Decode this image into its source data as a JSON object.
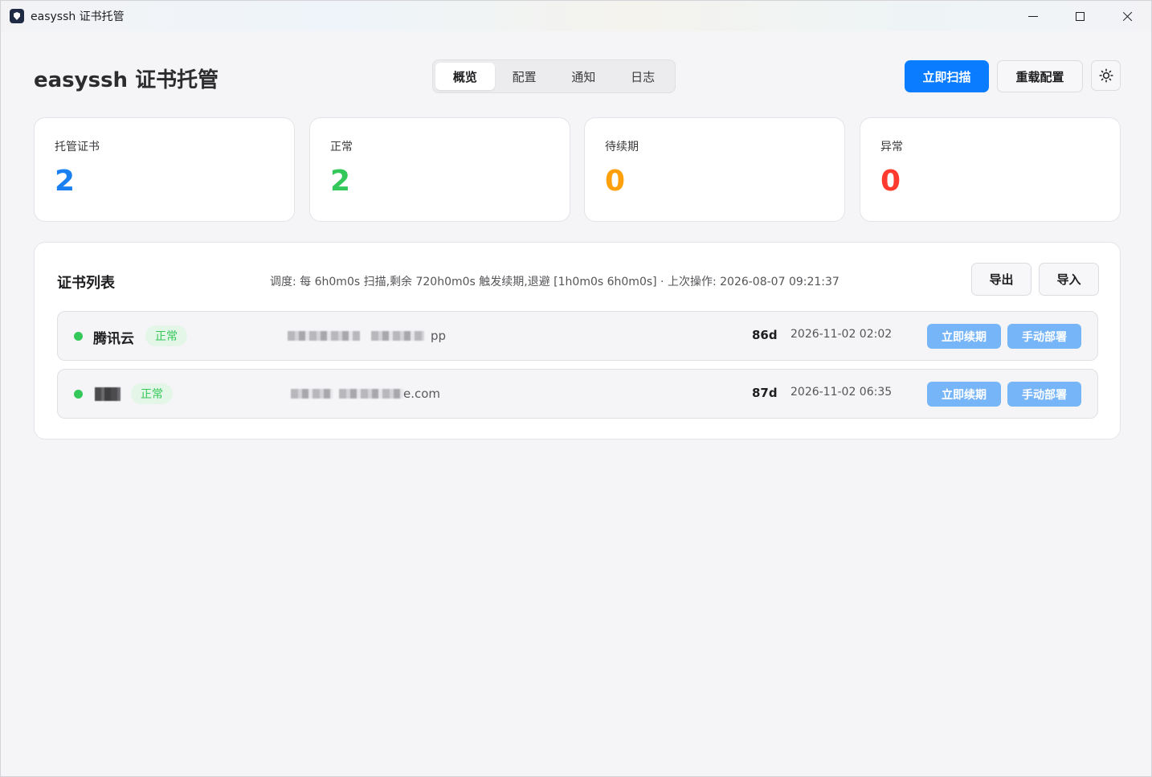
{
  "window": {
    "title": "easyssh 证书托管",
    "icon": "shield-icon"
  },
  "header": {
    "title": "easyssh 证书托管",
    "tabs": [
      {
        "label": "概览",
        "active": true
      },
      {
        "label": "配置",
        "active": false
      },
      {
        "label": "通知",
        "active": false
      },
      {
        "label": "日志",
        "active": false
      }
    ],
    "scan_label": "立即扫描",
    "reload_label": "重载配置",
    "theme_icon": "sun-icon"
  },
  "stats": [
    {
      "label": "托管证书",
      "value": "2",
      "color": "#1a7ff0"
    },
    {
      "label": "正常",
      "value": "2",
      "color": "#34c759"
    },
    {
      "label": "待续期",
      "value": "0",
      "color": "#ff9f0a"
    },
    {
      "label": "异常",
      "value": "0",
      "color": "#ff3b30"
    }
  ],
  "list": {
    "title": "证书列表",
    "schedule": "调度: 每 6h0m0s 扫描,剩余 720h0m0s 触发续期,退避 [1h0m0s 6h0m0s] · 上次操作: 2026-08-07 09:21:37",
    "export_label": "导出",
    "import_label": "导入",
    "rows": [
      {
        "name": "腾讯云",
        "status": "正常",
        "domain_tail": "pp",
        "days": "86d",
        "expires": "2026-11-02 02:02",
        "renew_label": "立即续期",
        "deploy_label": "手动部署"
      },
      {
        "name": "",
        "status": "正常",
        "domain_tail": "e.com",
        "days": "87d",
        "expires": "2026-11-02 06:35",
        "renew_label": "立即续期",
        "deploy_label": "手动部署"
      }
    ]
  }
}
